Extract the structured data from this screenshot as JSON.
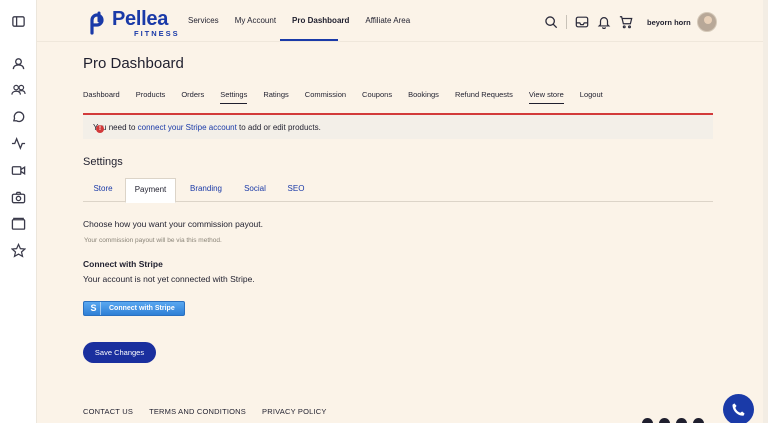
{
  "brand": {
    "name": "Pellea",
    "sub": "FITNESS",
    "color": "#1a3aa8"
  },
  "topnav": {
    "items": [
      "Services",
      "My Account",
      "Pro Dashboard",
      "Affiliate Area"
    ],
    "active_index": 2
  },
  "header": {
    "username": "beyorn horn"
  },
  "page_title": "Pro Dashboard",
  "dashboard_tabs": {
    "items": [
      "Dashboard",
      "Products",
      "Orders",
      "Settings",
      "Ratings",
      "Commission",
      "Coupons",
      "Bookings",
      "Refund Requests",
      "View store",
      "Logout"
    ],
    "active": "Settings"
  },
  "alert": {
    "prefix": "You need to ",
    "link": "connect your Stripe account",
    "suffix": " to add or edit products.",
    "color": "#d23a3a"
  },
  "settings": {
    "title": "Settings",
    "tabs": [
      "Store",
      "Payment",
      "Branding",
      "Social",
      "SEO"
    ],
    "active_tab": "Payment",
    "payout_question": "Choose how you want your commission payout.",
    "payout_hint": "Your commission payout will be via this method.",
    "stripe_title": "Connect with Stripe",
    "stripe_status": "Your account is not yet connected with Stripe.",
    "stripe_button": "Connect with Stripe",
    "stripe_button_glyph": "S",
    "save_button": "Save Changes"
  },
  "footer": {
    "links": [
      "CONTACT US",
      "TERMS AND CONDITIONS",
      "PRIVACY POLICY"
    ]
  },
  "rail_icons": [
    "sidebar-toggle-icon",
    "user-icon",
    "users-icon",
    "chat-icon",
    "activity-icon",
    "video-icon",
    "camera-icon",
    "folder-icon",
    "star-icon"
  ]
}
